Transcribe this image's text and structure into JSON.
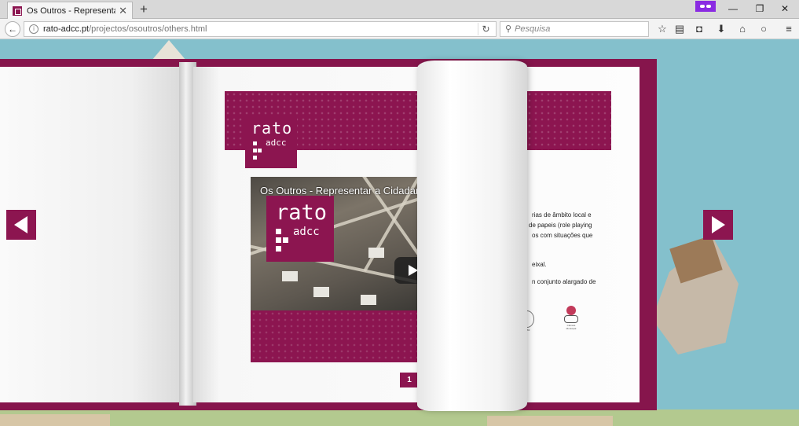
{
  "browser": {
    "tab_title": "Os Outros - Representar a ...",
    "tab_close": "✕",
    "newtab": "+",
    "url_host": "rato-adcc.pt",
    "url_path": "/projectos/osoutros/others.html",
    "search_placeholder": "Pesquisa",
    "icons": [
      "back-icon",
      "info-icon",
      "reload-icon",
      "search-icon",
      "bookmark-star-icon",
      "reading-list-icon",
      "pocket-icon",
      "download-icon",
      "home-icon",
      "chat-icon",
      "menu-icon"
    ],
    "accent": "#8a2be2"
  },
  "book": {
    "colors": {
      "brand": "#8c1550",
      "page": "#fdfdfd",
      "background": "#84c0cc"
    },
    "logo": {
      "name": "rato",
      "sub": "adcc"
    },
    "video": {
      "title": "Os Outros - Representar a Cidadan"
    },
    "text_lines": [
      "rias de âmbito local e",
      "de papeis (role playing",
      "os com situações que",
      "eixal.",
      "n conjunto alargado de"
    ],
    "partner_logos": [
      "eiro",
      "Câmara Municipal"
    ],
    "page_number": "1"
  }
}
